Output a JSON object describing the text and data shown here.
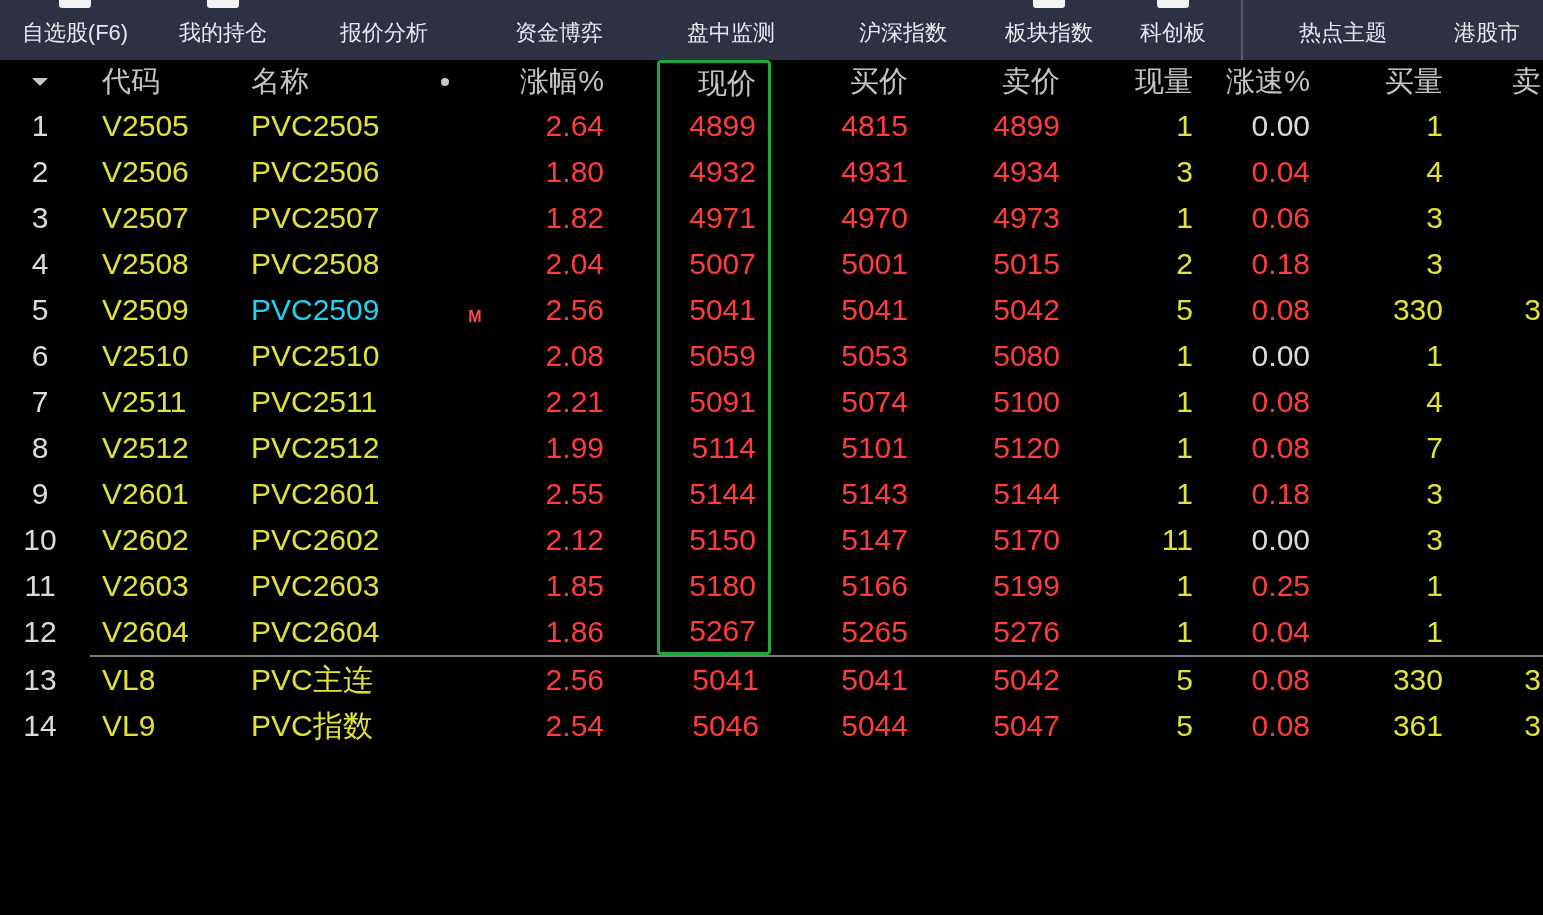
{
  "tabs": [
    {
      "label": "自选股(F6)",
      "has_icon": true
    },
    {
      "label": "我的持仓",
      "has_icon": true
    },
    {
      "label": "报价分析",
      "has_icon": false
    },
    {
      "label": "资金博弈",
      "has_icon": false
    },
    {
      "label": "盘中监测",
      "has_icon": false
    },
    {
      "label": "沪深指数",
      "has_icon": false
    },
    {
      "label": "板块指数",
      "has_icon": true
    },
    {
      "label": "科创板",
      "has_icon": true
    },
    {
      "label": "热点主题",
      "has_icon": false
    },
    {
      "label": "港股市",
      "has_icon": false
    }
  ],
  "table": {
    "columns": [
      {
        "kind": "sort",
        "highlighted": false
      },
      {
        "kind": "text",
        "label": "代码",
        "highlighted": false
      },
      {
        "kind": "text",
        "label": "名称",
        "highlighted": false
      },
      {
        "kind": "dot",
        "highlighted": false
      },
      {
        "kind": "num",
        "label": "涨幅%",
        "highlighted": false
      },
      {
        "kind": "num",
        "label": "现价",
        "highlighted": true
      },
      {
        "kind": "num",
        "label": "买价",
        "highlighted": false
      },
      {
        "kind": "num",
        "label": "卖价",
        "highlighted": false
      },
      {
        "kind": "num",
        "label": "现量",
        "highlighted": false
      },
      {
        "kind": "num",
        "label": "涨速%",
        "highlighted": false
      },
      {
        "kind": "num",
        "label": "买量",
        "highlighted": false
      },
      {
        "kind": "num",
        "label": "卖",
        "highlighted": false
      }
    ],
    "rows": [
      {
        "num": "1",
        "code": "V2505",
        "name": "PVC2505",
        "selected": false,
        "change": "2.64",
        "price": "4899",
        "bid": "4815",
        "ask": "4899",
        "volume": "1",
        "speed": {
          "value": "0.00",
          "color": "#dcdcdc"
        },
        "bid_volume": "1"
      },
      {
        "num": "2",
        "code": "V2506",
        "name": "PVC2506",
        "selected": false,
        "change": "1.80",
        "price": "4932",
        "bid": "4931",
        "ask": "4934",
        "volume": "3",
        "speed": {
          "value": "0.04",
          "color": "#ff3c3c"
        },
        "bid_volume": "4"
      },
      {
        "num": "3",
        "code": "V2507",
        "name": "PVC2507",
        "selected": false,
        "change": "1.82",
        "price": "4971",
        "bid": "4970",
        "ask": "4973",
        "volume": "1",
        "speed": {
          "value": "0.06",
          "color": "#ff3c3c"
        },
        "bid_volume": "3"
      },
      {
        "num": "4",
        "code": "V2508",
        "name": "PVC2508",
        "selected": false,
        "change": "2.04",
        "price": "5007",
        "bid": "5001",
        "ask": "5015",
        "volume": "2",
        "speed": {
          "value": "0.18",
          "color": "#ff3c3c"
        },
        "bid_volume": "3"
      },
      {
        "num": "5",
        "code": "V2509",
        "name": "PVC2509",
        "selected": true,
        "marker": "M",
        "change": "2.56",
        "price": "5041",
        "bid": "5041",
        "ask": "5042",
        "volume": "5",
        "speed": {
          "value": "0.08",
          "color": "#ff3c3c"
        },
        "bid_volume": "330",
        "ask_volume": "3"
      },
      {
        "num": "6",
        "code": "V2510",
        "name": "PVC2510",
        "selected": false,
        "change": "2.08",
        "price": "5059",
        "bid": "5053",
        "ask": "5080",
        "volume": "1",
        "speed": {
          "value": "0.00",
          "color": "#dcdcdc"
        },
        "bid_volume": "1"
      },
      {
        "num": "7",
        "code": "V2511",
        "name": "PVC2511",
        "selected": false,
        "change": "2.21",
        "price": "5091",
        "bid": "5074",
        "ask": "5100",
        "volume": "1",
        "speed": {
          "value": "0.08",
          "color": "#ff3c3c"
        },
        "bid_volume": "4"
      },
      {
        "num": "8",
        "code": "V2512",
        "name": "PVC2512",
        "selected": false,
        "change": "1.99",
        "price": "5114",
        "bid": "5101",
        "ask": "5120",
        "volume": "1",
        "speed": {
          "value": "0.08",
          "color": "#ff3c3c"
        },
        "bid_volume": "7"
      },
      {
        "num": "9",
        "code": "V2601",
        "name": "PVC2601",
        "selected": false,
        "change": "2.55",
        "price": "5144",
        "bid": "5143",
        "ask": "5144",
        "volume": "1",
        "speed": {
          "value": "0.18",
          "color": "#ff3c3c"
        },
        "bid_volume": "3"
      },
      {
        "num": "10",
        "code": "V2602",
        "name": "PVC2602",
        "selected": false,
        "change": "2.12",
        "price": "5150",
        "bid": "5147",
        "ask": "5170",
        "volume": "11",
        "speed": {
          "value": "0.00",
          "color": "#dcdcdc"
        },
        "bid_volume": "3"
      },
      {
        "num": "11",
        "code": "V2603",
        "name": "PVC2603",
        "selected": false,
        "change": "1.85",
        "price": "5180",
        "bid": "5166",
        "ask": "5199",
        "volume": "1",
        "speed": {
          "value": "0.25",
          "color": "#ff3c3c"
        },
        "bid_volume": "1"
      },
      {
        "num": "12",
        "code": "V2604",
        "name": "PVC2604",
        "selected": false,
        "change": "1.86",
        "price": "5267",
        "bid": "5265",
        "ask": "5276",
        "volume": "1",
        "speed": {
          "value": "0.04",
          "color": "#ff3c3c"
        },
        "bid_volume": "1"
      }
    ],
    "pinned_rows": [
      {
        "num": "13",
        "code": "VL8",
        "name": "PVC主连",
        "selected": false,
        "change": "2.56",
        "price": "5041",
        "bid": "5041",
        "ask": "5042",
        "volume": "5",
        "speed": {
          "value": "0.08",
          "color": "#ff3c3c"
        },
        "bid_volume": "330",
        "ask_volume": "3"
      },
      {
        "num": "14",
        "code": "VL9",
        "name": "PVC指数",
        "selected": false,
        "change": "2.54",
        "price": "5046",
        "bid": "5044",
        "ask": "5047",
        "volume": "5",
        "speed": {
          "value": "0.08",
          "color": "#ff3c3c"
        },
        "bid_volume": "361",
        "ask_volume": "3"
      }
    ]
  }
}
